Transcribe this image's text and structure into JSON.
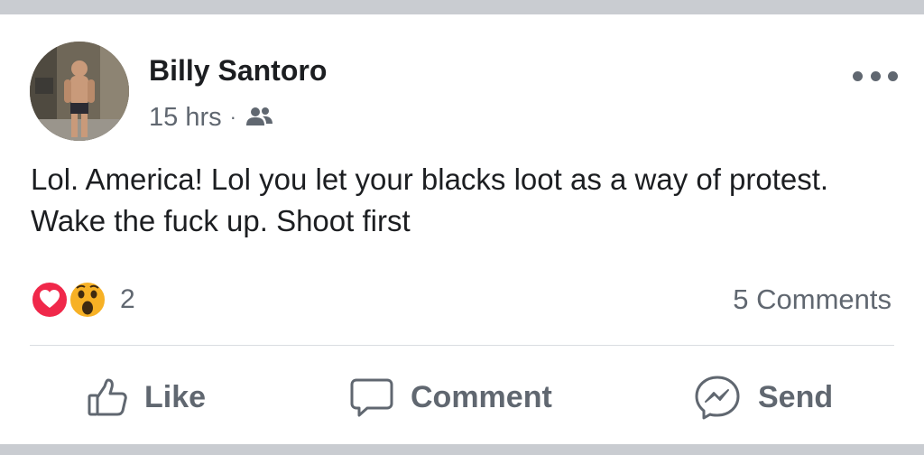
{
  "post": {
    "author": "Billy Santoro",
    "timestamp": "15 hrs",
    "separator": "·",
    "audience_icon": "friends-icon",
    "menu_icon": "more-options-icon",
    "text": "Lol. America! Lol you let your blacks loot as a way of protest. Wake the fuck up. Shoot first"
  },
  "reactions": {
    "types": [
      "love",
      "wow"
    ],
    "count": "2",
    "comments": "5 Comments"
  },
  "actions": {
    "like_label": "Like",
    "comment_label": "Comment",
    "send_label": "Send"
  },
  "colors": {
    "love": "#f0284a",
    "wow": "#f7b125",
    "text": "#1c1e21",
    "secondary": "#606770",
    "divider": "#dadde1",
    "band": "#c9ccd1"
  }
}
